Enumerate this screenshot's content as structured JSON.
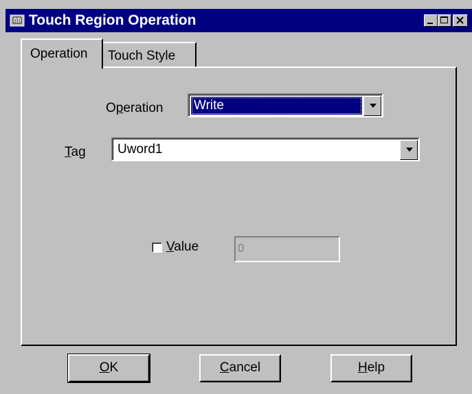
{
  "window": {
    "title": "Touch Region Operation"
  },
  "tabs": [
    {
      "label": "Operation",
      "active": true
    },
    {
      "label": "Touch Style",
      "active": false
    }
  ],
  "form": {
    "operation_label_pre": "O",
    "operation_label_mnemonic": "p",
    "operation_label_post": "eration",
    "operation_value": "Write",
    "tag_label_mnemonic": "T",
    "tag_label_post": "ag",
    "tag_value": "Uword1",
    "value_checkbox_checked": false,
    "value_label_mnemonic": "V",
    "value_label_post": "alue",
    "value_field": "0"
  },
  "buttons": {
    "ok_mnemonic": "O",
    "ok_post": "K",
    "cancel_mnemonic": "C",
    "cancel_post": "ancel",
    "help_mnemonic": "H",
    "help_post": "elp"
  },
  "icons": {
    "app": "touch-region-icon",
    "minimize": "minimize-icon",
    "maximize": "maximize-icon",
    "close": "close-icon",
    "dropdown": "chevron-down-icon"
  },
  "colors": {
    "titlebar": "#000080",
    "face": "#c0c0c0",
    "selection": "#000080"
  }
}
